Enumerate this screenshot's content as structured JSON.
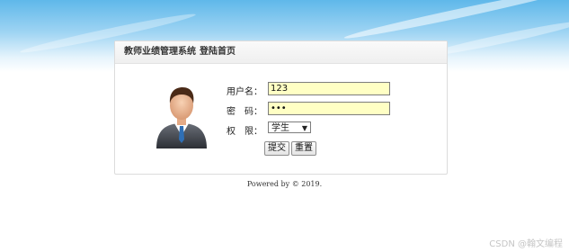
{
  "panel": {
    "title": "教师业绩管理系统",
    "subtitle": "登陆首页"
  },
  "form": {
    "username_label": "用户名：",
    "username_value": "123",
    "password_label": "密　码：",
    "password_value": "•••",
    "role_label": "权　限：",
    "role_selected": "学生",
    "submit_label": "提交",
    "reset_label": "重置"
  },
  "footer": {
    "text": "Powered by © 2019."
  },
  "watermark": {
    "text": "CSDN @翰文编程"
  },
  "colors": {
    "input_bg": "#ffffc4",
    "sky": "#5fb8ea"
  },
  "icons": {
    "avatar": "businessman-avatar-icon",
    "dropdown": "triangle-down-icon"
  }
}
